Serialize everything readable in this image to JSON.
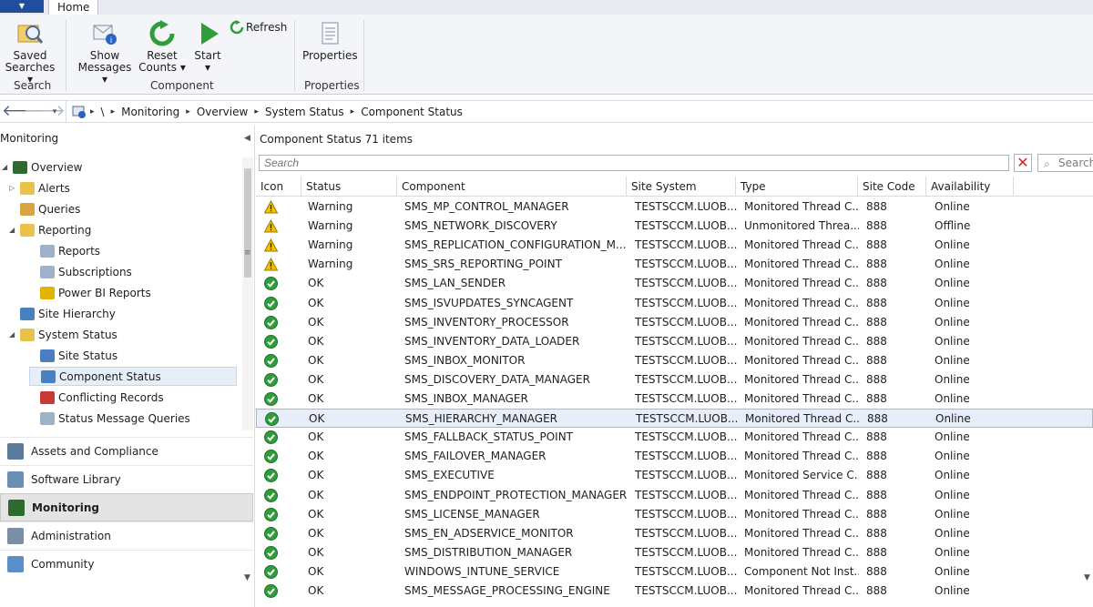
{
  "ribbon": {
    "app_menu_glyph": "▼",
    "tab_home": "Home",
    "saved_searches_l1": "Saved",
    "saved_searches_l2": "Searches ▾",
    "group_search": "Search",
    "show_messages_l1": "Show",
    "show_messages_l2": "Messages ▾",
    "reset_counts_l1": "Reset",
    "reset_counts_l2": "Counts ▾",
    "start_l1": "Start",
    "start_l2": "▾",
    "refresh": "Refresh",
    "group_component": "Component",
    "properties": "Properties",
    "group_properties": "Properties"
  },
  "address_bar": {
    "back_glyph": "🡐",
    "forward_glyph": "🡒",
    "root": "\\",
    "breadcrumbs": [
      "Monitoring",
      "Overview",
      "System Status",
      "Component Status"
    ]
  },
  "nav": {
    "header": "Monitoring",
    "tree": [
      {
        "label": "Overview",
        "indent": 0,
        "expander": "◢",
        "icon": "overview-icon",
        "color": "#2e6a2e"
      },
      {
        "label": "Alerts",
        "indent": 1,
        "expander": "▷",
        "icon": "folder-icon",
        "color": "#e8c24a"
      },
      {
        "label": "Queries",
        "indent": 1,
        "expander": "",
        "icon": "queries-icon",
        "color": "#d9a441"
      },
      {
        "label": "Reporting",
        "indent": 1,
        "expander": "◢",
        "icon": "folder-icon",
        "color": "#e8c24a"
      },
      {
        "label": "Reports",
        "indent": 2,
        "expander": "",
        "icon": "report-icon",
        "color": "#9fb3c8"
      },
      {
        "label": "Subscriptions",
        "indent": 2,
        "expander": "",
        "icon": "subscription-icon",
        "color": "#9fb3c8"
      },
      {
        "label": "Power BI Reports",
        "indent": 2,
        "expander": "",
        "icon": "powerbi-icon",
        "color": "#e1b400"
      },
      {
        "label": "Site Hierarchy",
        "indent": 1,
        "expander": "",
        "icon": "hierarchy-icon",
        "color": "#4a7fc1"
      },
      {
        "label": "System Status",
        "indent": 1,
        "expander": "◢",
        "icon": "folder-icon",
        "color": "#e8c24a"
      },
      {
        "label": "Site Status",
        "indent": 2,
        "expander": "",
        "icon": "site-status-icon",
        "color": "#4a7fc1"
      },
      {
        "label": "Component Status",
        "indent": 2,
        "expander": "",
        "icon": "component-status-icon",
        "color": "#4a7fc1",
        "selected": true
      },
      {
        "label": "Conflicting Records",
        "indent": 2,
        "expander": "",
        "icon": "conflict-icon",
        "color": "#c83a3a"
      },
      {
        "label": "Status Message Queries",
        "indent": 2,
        "expander": "",
        "icon": "status-query-icon",
        "color": "#9fb3c8"
      }
    ],
    "wunderbar": [
      {
        "label": "Assets and Compliance",
        "icon": "assets-icon",
        "color": "#5a7a9a"
      },
      {
        "label": "Software Library",
        "icon": "library-icon",
        "color": "#6b8fb3"
      },
      {
        "label": "Monitoring",
        "icon": "monitoring-icon",
        "color": "#2e6a2e",
        "active": true
      },
      {
        "label": "Administration",
        "icon": "administration-icon",
        "color": "#7a8ea6"
      },
      {
        "label": "Community",
        "icon": "community-icon",
        "color": "#5b8fc9"
      }
    ]
  },
  "main": {
    "title": "Component Status",
    "count": "71 items",
    "search_placeholder": "Search",
    "search_button": "Search",
    "columns": [
      "Icon",
      "Status",
      "Component",
      "Site System",
      "Type",
      "Site Code",
      "Availability"
    ],
    "rows": [
      {
        "icon": "warning",
        "status": "Warning",
        "component": "SMS_MP_CONTROL_MANAGER",
        "site_system": "TESTSCCM.LUOB...",
        "type": "Monitored Thread C...",
        "site_code": "888",
        "availability": "Online"
      },
      {
        "icon": "warning",
        "status": "Warning",
        "component": "SMS_NETWORK_DISCOVERY",
        "site_system": "TESTSCCM.LUOB...",
        "type": "Unmonitored Threa...",
        "site_code": "888",
        "availability": "Offline"
      },
      {
        "icon": "warning",
        "status": "Warning",
        "component": "SMS_REPLICATION_CONFIGURATION_M...",
        "site_system": "TESTSCCM.LUOB...",
        "type": "Monitored Thread C...",
        "site_code": "888",
        "availability": "Online"
      },
      {
        "icon": "warning",
        "status": "Warning",
        "component": "SMS_SRS_REPORTING_POINT",
        "site_system": "TESTSCCM.LUOB...",
        "type": "Monitored Thread C...",
        "site_code": "888",
        "availability": "Online"
      },
      {
        "icon": "ok",
        "status": "OK",
        "component": "SMS_LAN_SENDER",
        "site_system": "TESTSCCM.LUOB...",
        "type": "Monitored Thread C...",
        "site_code": "888",
        "availability": "Online"
      },
      {
        "icon": "ok",
        "status": "OK",
        "component": "SMS_ISVUPDATES_SYNCAGENT",
        "site_system": "TESTSCCM.LUOB...",
        "type": "Monitored Thread C...",
        "site_code": "888",
        "availability": "Online"
      },
      {
        "icon": "ok",
        "status": "OK",
        "component": "SMS_INVENTORY_PROCESSOR",
        "site_system": "TESTSCCM.LUOB...",
        "type": "Monitored Thread C...",
        "site_code": "888",
        "availability": "Online"
      },
      {
        "icon": "ok",
        "status": "OK",
        "component": "SMS_INVENTORY_DATA_LOADER",
        "site_system": "TESTSCCM.LUOB...",
        "type": "Monitored Thread C...",
        "site_code": "888",
        "availability": "Online"
      },
      {
        "icon": "ok",
        "status": "OK",
        "component": "SMS_INBOX_MONITOR",
        "site_system": "TESTSCCM.LUOB...",
        "type": "Monitored Thread C...",
        "site_code": "888",
        "availability": "Online"
      },
      {
        "icon": "ok",
        "status": "OK",
        "component": "SMS_DISCOVERY_DATA_MANAGER",
        "site_system": "TESTSCCM.LUOB...",
        "type": "Monitored Thread C...",
        "site_code": "888",
        "availability": "Online"
      },
      {
        "icon": "ok",
        "status": "OK",
        "component": "SMS_INBOX_MANAGER",
        "site_system": "TESTSCCM.LUOB...",
        "type": "Monitored Thread C...",
        "site_code": "888",
        "availability": "Online"
      },
      {
        "icon": "ok",
        "status": "OK",
        "component": "SMS_HIERARCHY_MANAGER",
        "site_system": "TESTSCCM.LUOB...",
        "type": "Monitored Thread C...",
        "site_code": "888",
        "availability": "Online",
        "selected": true
      },
      {
        "icon": "ok",
        "status": "OK",
        "component": "SMS_FALLBACK_STATUS_POINT",
        "site_system": "TESTSCCM.LUOB...",
        "type": "Monitored Thread C...",
        "site_code": "888",
        "availability": "Online"
      },
      {
        "icon": "ok",
        "status": "OK",
        "component": "SMS_FAILOVER_MANAGER",
        "site_system": "TESTSCCM.LUOB...",
        "type": "Monitored Thread C...",
        "site_code": "888",
        "availability": "Online"
      },
      {
        "icon": "ok",
        "status": "OK",
        "component": "SMS_EXECUTIVE",
        "site_system": "TESTSCCM.LUOB...",
        "type": "Monitored Service C...",
        "site_code": "888",
        "availability": "Online"
      },
      {
        "icon": "ok",
        "status": "OK",
        "component": "SMS_ENDPOINT_PROTECTION_MANAGER",
        "site_system": "TESTSCCM.LUOB...",
        "type": "Monitored Thread C...",
        "site_code": "888",
        "availability": "Online"
      },
      {
        "icon": "ok",
        "status": "OK",
        "component": "SMS_LICENSE_MANAGER",
        "site_system": "TESTSCCM.LUOB...",
        "type": "Monitored Thread C...",
        "site_code": "888",
        "availability": "Online"
      },
      {
        "icon": "ok",
        "status": "OK",
        "component": "SMS_EN_ADSERVICE_MONITOR",
        "site_system": "TESTSCCM.LUOB...",
        "type": "Monitored Thread C...",
        "site_code": "888",
        "availability": "Online"
      },
      {
        "icon": "ok",
        "status": "OK",
        "component": "SMS_DISTRIBUTION_MANAGER",
        "site_system": "TESTSCCM.LUOB...",
        "type": "Monitored Thread C...",
        "site_code": "888",
        "availability": "Online"
      },
      {
        "icon": "ok",
        "status": "OK",
        "component": "WINDOWS_INTUNE_SERVICE",
        "site_system": "TESTSCCM.LUOB...",
        "type": "Component Not Inst...",
        "site_code": "888",
        "availability": "Online"
      },
      {
        "icon": "ok",
        "status": "OK",
        "component": "SMS_MESSAGE_PROCESSING_ENGINE",
        "site_system": "TESTSCCM.LUOB...",
        "type": "Monitored Thread C...",
        "site_code": "888",
        "availability": "Online"
      }
    ]
  },
  "colors": {
    "accent": "#1f4f9c",
    "ok_green": "#2f9e3a",
    "warning_yellow": "#f2c200",
    "selection": "#e7eef9"
  }
}
